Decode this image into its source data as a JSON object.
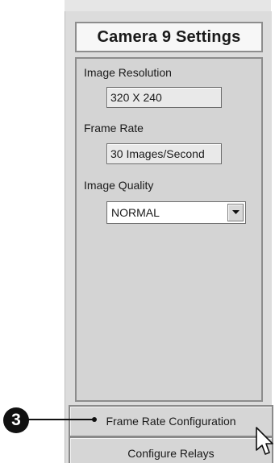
{
  "panel": {
    "title": "Camera 9 Settings"
  },
  "settings": {
    "resolution": {
      "label": "Image Resolution",
      "value": "320 X 240"
    },
    "frame_rate": {
      "label": "Frame Rate",
      "value": "30 Images/Second"
    },
    "quality": {
      "label": "Image Quality",
      "selected": "NORMAL"
    }
  },
  "buttons": {
    "frame_rate_config": "Frame Rate Configuration",
    "configure_relays": "Configure Relays"
  },
  "callout": {
    "number": "3"
  },
  "icons": {
    "dropdown": "chevron-down-icon",
    "cursor": "mouse-pointer-icon"
  }
}
